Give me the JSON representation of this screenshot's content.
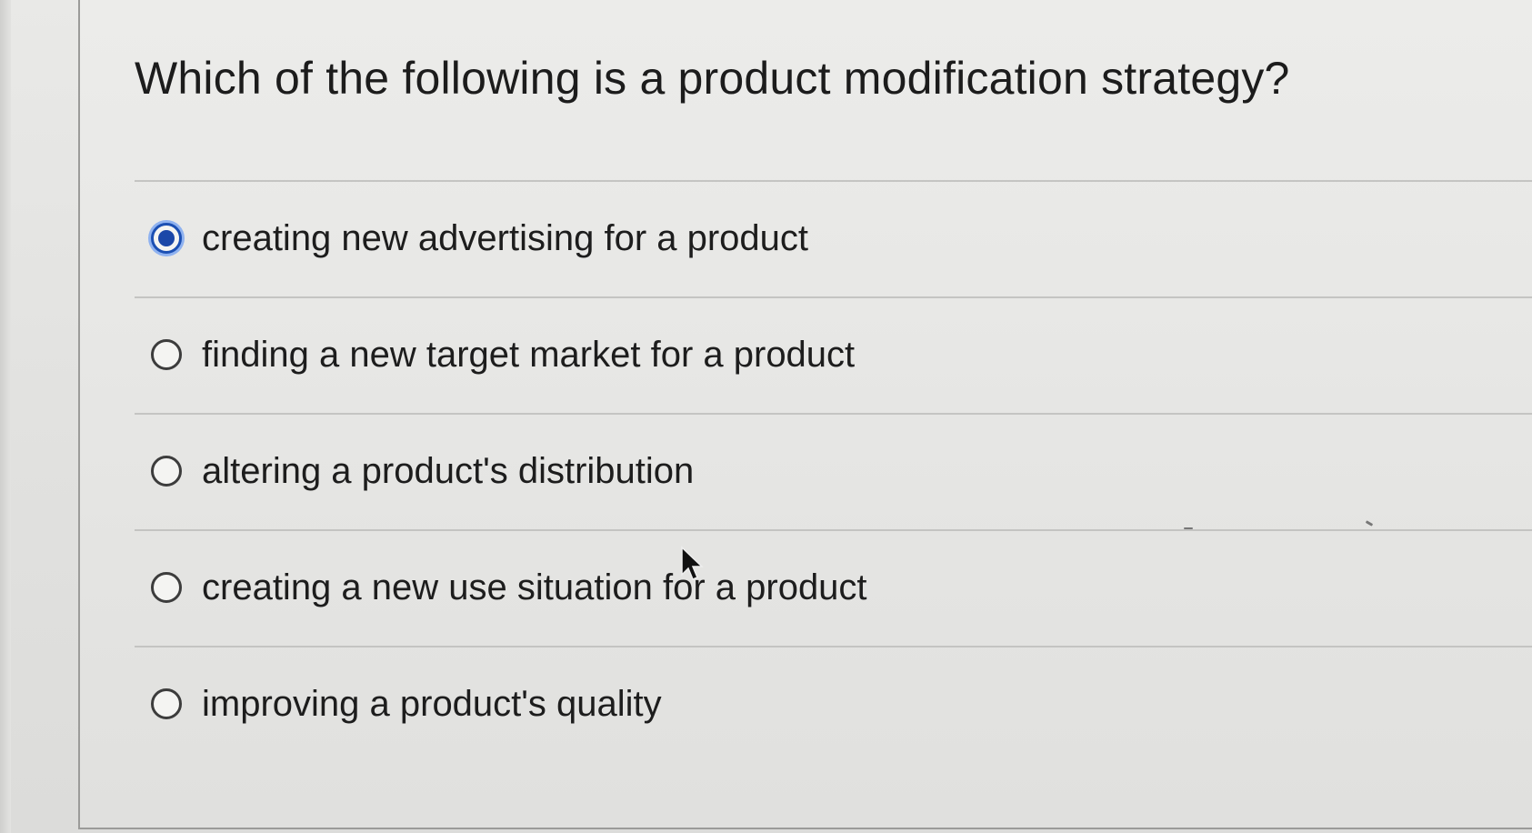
{
  "question": {
    "text": "Which of the following is a product modification strategy?"
  },
  "options": [
    {
      "label": "creating new advertising for a product",
      "selected": true
    },
    {
      "label": "finding a new target market for a product",
      "selected": false
    },
    {
      "label": "altering a product's distribution",
      "selected": false
    },
    {
      "label": "creating a new use situation for a product",
      "selected": false
    },
    {
      "label": "improving a product's quality",
      "selected": false
    }
  ],
  "colors": {
    "radio_selected": "#1b47a8",
    "radio_focus_ring": "#8fb2f0",
    "text": "#1d1d1d"
  },
  "icons": {
    "cursor": "mouse-pointer-icon"
  }
}
